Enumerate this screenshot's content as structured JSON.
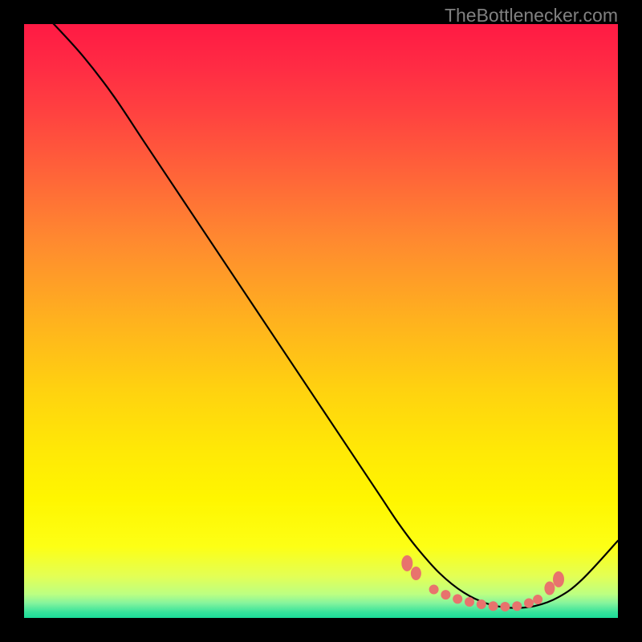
{
  "attribution": "TheBottlenecker.com",
  "colors": {
    "gradient": {
      "stops": [
        {
          "offset": 0.0,
          "color": "#ff1a44"
        },
        {
          "offset": 0.07,
          "color": "#ff2b44"
        },
        {
          "offset": 0.15,
          "color": "#ff4240"
        },
        {
          "offset": 0.25,
          "color": "#ff6339"
        },
        {
          "offset": 0.36,
          "color": "#ff8830"
        },
        {
          "offset": 0.5,
          "color": "#ffb21e"
        },
        {
          "offset": 0.62,
          "color": "#ffd30f"
        },
        {
          "offset": 0.72,
          "color": "#ffe906"
        },
        {
          "offset": 0.8,
          "color": "#fff600"
        },
        {
          "offset": 0.88,
          "color": "#fdff15"
        },
        {
          "offset": 0.93,
          "color": "#e3ff55"
        },
        {
          "offset": 0.96,
          "color": "#bcff82"
        },
        {
          "offset": 0.975,
          "color": "#85f49d"
        },
        {
          "offset": 0.99,
          "color": "#38e39b"
        },
        {
          "offset": 1.0,
          "color": "#1bdc98"
        }
      ]
    },
    "curve": "#000000",
    "marker_fill": "#e8736d",
    "marker_stroke": "#e8736d"
  },
  "chart_data": {
    "type": "line",
    "title": "",
    "xlabel": "",
    "ylabel": "",
    "xlim": [
      0,
      100
    ],
    "ylim": [
      0,
      100
    ],
    "series": [
      {
        "name": "bottleneck-curve",
        "x": [
          0,
          5,
          10,
          15,
          20,
          25,
          30,
          35,
          40,
          45,
          50,
          55,
          60,
          63,
          66,
          70,
          74,
          78,
          82,
          86,
          90,
          94,
          100
        ],
        "y": [
          105,
          100,
          94.5,
          88,
          80.5,
          73,
          65.5,
          58,
          50.5,
          43,
          35.5,
          28,
          20.5,
          16,
          12,
          7.5,
          4.3,
          2.4,
          1.7,
          2.0,
          3.5,
          6.5,
          13
        ]
      }
    ],
    "markers": {
      "name": "optimal-band",
      "points": [
        {
          "x": 64.5,
          "y": 9.2
        },
        {
          "x": 66.0,
          "y": 7.5
        },
        {
          "x": 69.0,
          "y": 4.8
        },
        {
          "x": 71.0,
          "y": 3.9
        },
        {
          "x": 73.0,
          "y": 3.2
        },
        {
          "x": 75.0,
          "y": 2.7
        },
        {
          "x": 77.0,
          "y": 2.3
        },
        {
          "x": 79.0,
          "y": 2.0
        },
        {
          "x": 81.0,
          "y": 1.9
        },
        {
          "x": 83.0,
          "y": 2.0
        },
        {
          "x": 85.0,
          "y": 2.5
        },
        {
          "x": 86.5,
          "y": 3.1
        },
        {
          "x": 88.5,
          "y": 5.0
        },
        {
          "x": 90.0,
          "y": 6.5
        }
      ]
    }
  }
}
